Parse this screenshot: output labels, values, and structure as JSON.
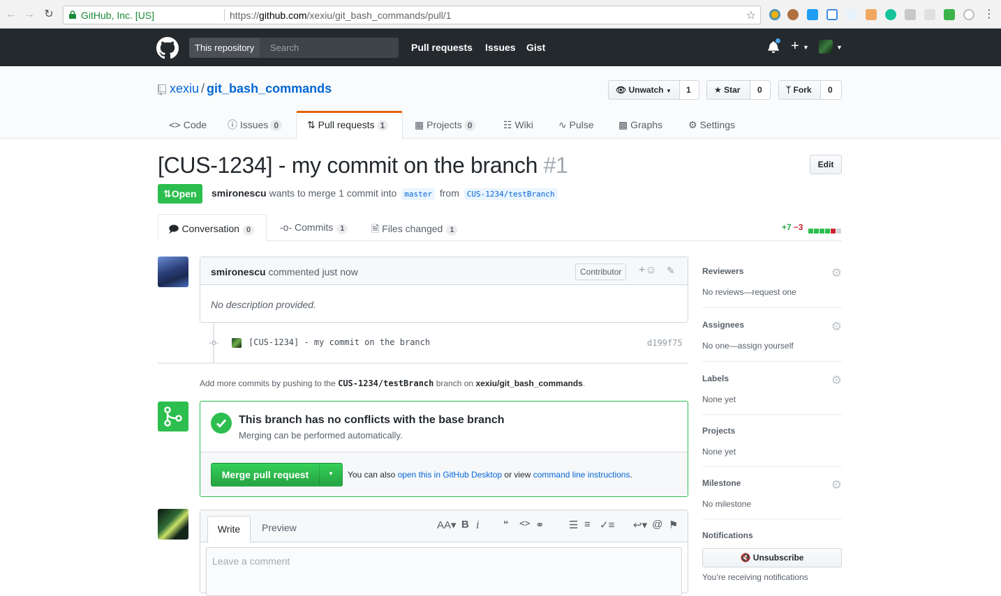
{
  "browser": {
    "secure_label": "GitHub, Inc. [US]",
    "url_scheme": "https://",
    "url_host": "github.com",
    "url_path": "/xexiu/git_bash_commands/pull/1"
  },
  "header": {
    "search_scope": "This repository",
    "search_placeholder": "Search",
    "nav": [
      "Pull requests",
      "Issues",
      "Gist"
    ]
  },
  "repo": {
    "owner": "xexiu",
    "name": "git_bash_commands",
    "watch_label": "Unwatch",
    "watch_count": "1",
    "star_label": "Star",
    "star_count": "0",
    "fork_label": "Fork",
    "fork_count": "0"
  },
  "reponav": {
    "code": "Code",
    "issues": "Issues",
    "issues_count": "0",
    "pulls": "Pull requests",
    "pulls_count": "1",
    "projects": "Projects",
    "projects_count": "0",
    "wiki": "Wiki",
    "pulse": "Pulse",
    "graphs": "Graphs",
    "settings": "Settings"
  },
  "pr": {
    "title": "[CUS-1234] - my commit on the branch",
    "number": "#1",
    "edit_label": "Edit",
    "state": "Open",
    "author": "smironescu",
    "meta_mid": "wants to merge 1 commit into",
    "base_branch": "master",
    "meta_from": "from",
    "head_branch": "CUS-1234/testBranch"
  },
  "tabs": {
    "conversation": "Conversation",
    "conversation_count": "0",
    "commits": "Commits",
    "commits_count": "1",
    "files": "Files changed",
    "files_count": "1",
    "additions": "+7",
    "deletions": "−3"
  },
  "comment": {
    "author": "smironescu",
    "action": "commented just now",
    "badge": "Contributor",
    "body": "No description provided."
  },
  "commit": {
    "message": "[CUS-1234] - my commit on the branch",
    "sha": "d199f75"
  },
  "push_hint": {
    "prefix": "Add more commits by pushing to the",
    "branch": "CUS-1234/testBranch",
    "mid": "branch on",
    "repo": "xexiu/git_bash_commands",
    "suffix": "."
  },
  "merge": {
    "title": "This branch has no conflicts with the base branch",
    "subtitle": "Merging can be performed automatically.",
    "button": "Merge pull request",
    "note_prefix": "You can also",
    "desktop_link": "open this in GitHub Desktop",
    "note_mid": "or view",
    "cli_link": "command line instructions",
    "note_suffix": "."
  },
  "new_comment": {
    "write_tab": "Write",
    "preview_tab": "Preview",
    "placeholder": "Leave a comment"
  },
  "sidebar": {
    "reviewers_title": "Reviewers",
    "reviewers_value": "No reviews—request one",
    "assignees_title": "Assignees",
    "assignees_value": "No one—assign yourself",
    "labels_title": "Labels",
    "labels_value": "None yet",
    "projects_title": "Projects",
    "projects_value": "None yet",
    "milestone_title": "Milestone",
    "milestone_value": "No milestone",
    "notifications_title": "Notifications",
    "unsubscribe_label": "Unsubscribe",
    "receiving_text": "You’re receiving notifications"
  },
  "colors": {
    "success": "#2cbe4e",
    "link": "#0366d6",
    "header_bg": "#24292e",
    "tab_accent": "#e36209"
  }
}
